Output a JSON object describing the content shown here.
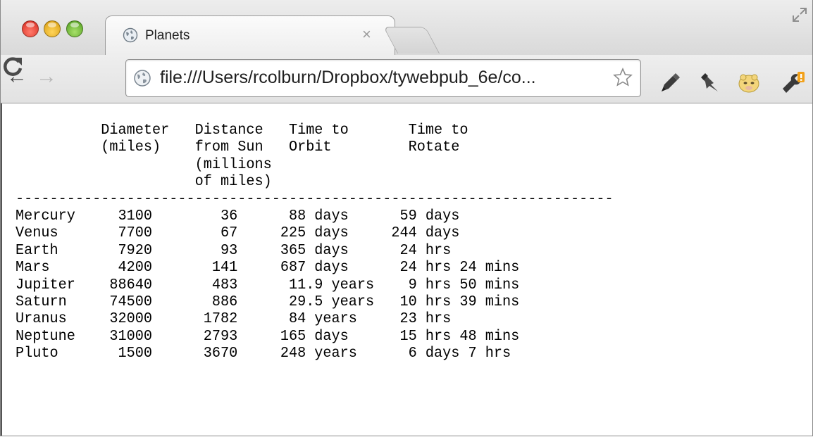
{
  "window": {
    "tab_title": "Planets",
    "tab_close_glyph": "×",
    "url": "file:///Users/rcolburn/Dropbox/tywebpub_6e/co...",
    "back_glyph": "←",
    "forward_glyph": "→"
  },
  "icons": {
    "tab_favicon": "globe-icon",
    "url": "globe-icon",
    "bookmark": "star-icon",
    "extensions": [
      "pen-icon",
      "pin-icon",
      "face-icon",
      "wrench-icon"
    ]
  },
  "colors": {
    "chrome_bg": "#e2e2e2",
    "close_button": "#d6261b",
    "minimize_button": "#d69a0b",
    "zoom_button": "#4e9b1b",
    "wrench_badge": "#f2a11a"
  },
  "page": {
    "header": [
      "          Diameter   Distance   Time to       Time to",
      "          (miles)    from Sun   Orbit         Rotate",
      "                     (millions",
      "                     of miles)"
    ],
    "separator": "----------------------------------------------------------------------",
    "rows": [
      "Mercury     3100        36      88 days      59 days",
      "Venus       7700        67     225 days     244 days",
      "Earth       7920        93     365 days      24 hrs",
      "Mars        4200       141     687 days      24 hrs 24 mins",
      "Jupiter    88640       483      11.9 years    9 hrs 50 mins",
      "Saturn     74500       886      29.5 years   10 hrs 39 mins",
      "Uranus     32000      1782      84 years     23 hrs",
      "Neptune    31000      2793     165 days      15 hrs 48 mins",
      "Pluto       1500      3670     248 years      6 days 7 hrs"
    ]
  }
}
